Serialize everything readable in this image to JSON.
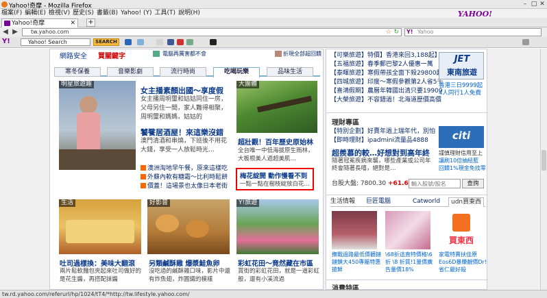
{
  "window": {
    "title": "Yahoo!奇摩 - Mozilla Firefox"
  },
  "menu": [
    "檔案(F)",
    "編輯(E)",
    "檢視(V)",
    "歷史(S)",
    "書籤(B)",
    "Yahoo! (Y)",
    "工具(T)",
    "說明(H)"
  ],
  "menu_logo": "YAHOO!",
  "tab": {
    "label": "Yahoo!奇摩"
  },
  "url": "tw.yahoo.com",
  "searchbox_placeholder": "Yahoo",
  "yahoo_toolbar": {
    "input_value": "Yahoo! Search",
    "search_label": "SEARCH"
  },
  "top_strip": {
    "left": "網路安全",
    "left2": "買關鍵字",
    "mid": "電腦再厲害都不會",
    "right": "折現全部超回饋"
  },
  "channel_tabs": [
    "寒冬保養",
    "音樂影劇",
    "流行時尚",
    "吃喝玩樂",
    "品味生活"
  ],
  "active_tab": 3,
  "feature": {
    "tag": "明星旅遊趣",
    "headline": "女主播素顏出國～享度假",
    "body": "女主播周明璽和姑姑同住一房，父母另住一間，家人難得相聚，周明璽和媽媽，姑姑的",
    "headline2": "饕餮居酒屋！來這樂沒錯",
    "body2": "澳門清酒和串燒，下班後不用花大錢，享受一人放鬆時光…"
  },
  "feature_links": [
    "澳洲淘地早午餐，原來這樣吃",
    "外蘇內軟有糖霜～比利時鬆餅",
    "價蓋！這場景也太像日本老街"
  ],
  "nature": {
    "tag": "大團體",
    "headline": "超壯觀！百年歷史原始林",
    "body": "全台唯一中低海拔原生雨林，大板根美人過超美肌…"
  },
  "highlight": {
    "headline": "梅花綻開 動作慢看不到",
    "body": "一點一點在樹枝綻放白花…"
  },
  "cards": [
    {
      "tag": "生活",
      "headline": "吐司過樣換：美味大翻滾",
      "body": "兩片鬆軟麵包夾起來吐司做好的是花生醬，再搭配抹醬"
    },
    {
      "tag": "好影音",
      "headline": "另類鹹酥雞 爆漿鮭魚卵",
      "body": "沒吃過的鹹酥雞口味，影片中還有炸魚翅，炸圓鐵的模樣"
    },
    {
      "tag": "Y!旅遊",
      "headline": "彩虹花田～竟然藏在市區",
      "body": "賞街的彩虹花田，就是一道彩虹般，還有小溪流過"
    }
  ],
  "travel_list": [
    "【可樂旅遊】特價】香港來回3,188起】",
    "【五福旅遊】春季郵巴黎2人優惠一萬",
    "【泰暉旅遊】寒假帶孩全面下殺29800起",
    "【四城旅遊】印度～寒假參觀第2人省5千",
    "【喜鴻假期】農曆年韓國出清只要19900",
    "【大榮旅遊】不容錯過！北海道歷價高價"
  ],
  "jet_ad": {
    "logo": "JET",
    "name": "東南旅遊",
    "line1": "香港三日9999起",
    "line2": "4人同行1人免費"
  },
  "finance": {
    "title": "理財專區",
    "links": [
      "【特別企劃】好賣年過上瑞年代，別怕",
      "【即時理財】ipadmini流量品4888"
    ],
    "headline": "超羨慕的較…好想對到高年終",
    "body": "隨著冠冕疾病來襲，哪些產業或公司年終會隨著長嘻，絕對是…",
    "index_label": "台股大盤:",
    "index_value": "7800.30",
    "index_change": "+61.66",
    "stock_placeholder": "輸入股號/股名",
    "query_button": "查詢"
  },
  "citi_ad": {
    "logo": "citi",
    "line1": "謹慎理財信用至上",
    "line2": "讓刷10倍抽紐藍",
    "line3": "回饋1%現金免找零"
  },
  "shopping": {
    "tabs": [
      "生活情報",
      "巨匠電腦",
      "Catworld",
      "udn買東西"
    ],
    "items": [
      {
        "caption": "撫戰過路最低價髒鏈鏈鎖大450專屬特惠搶鮮"
      },
      {
        "caption": "\\68折這直特價格\\6折 \\8 折質!1量價廣告量價18%"
      },
      {
        "caption": "家電特賣扶佳原Eos6D暴賺靚價Dr!省仁最好殺"
      }
    ],
    "udn_logo": "買東西"
  },
  "consume": {
    "title": "消費特區"
  },
  "status": "tw.rd.yahoo.com/referurl/hp/1024/tT4/*http://tw.lifestyle.yahoo.com/"
}
